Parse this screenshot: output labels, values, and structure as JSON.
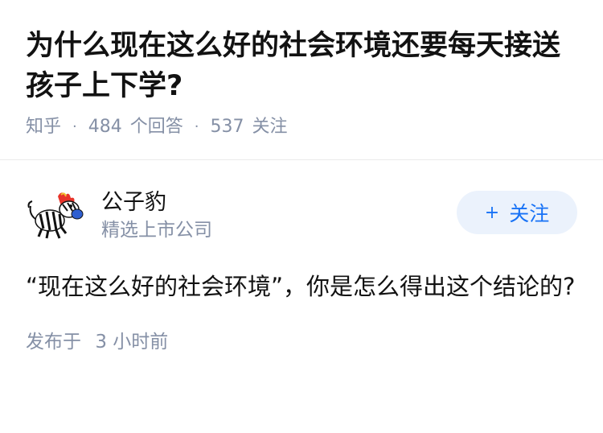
{
  "question": {
    "title": "为什么现在这么好的社会环境还要每天接送孩子上下学?",
    "source": "知乎",
    "answer_count": "484",
    "answer_label": "个回答",
    "follower_count": "537",
    "follower_label": "关注"
  },
  "answer": {
    "author_name": "公子豹",
    "author_desc": "精选上市公司",
    "follow_button": {
      "icon": "+",
      "label": "关注"
    },
    "content": "“现在这么好的社会环境”，你是怎么得出这个结论的?",
    "time_prefix": "发布于",
    "time_value": "3 小时前"
  },
  "colors": {
    "accent": "#1772f6",
    "button_bg": "#ebf2fc",
    "meta": "#8590a6",
    "title": "#121212"
  }
}
